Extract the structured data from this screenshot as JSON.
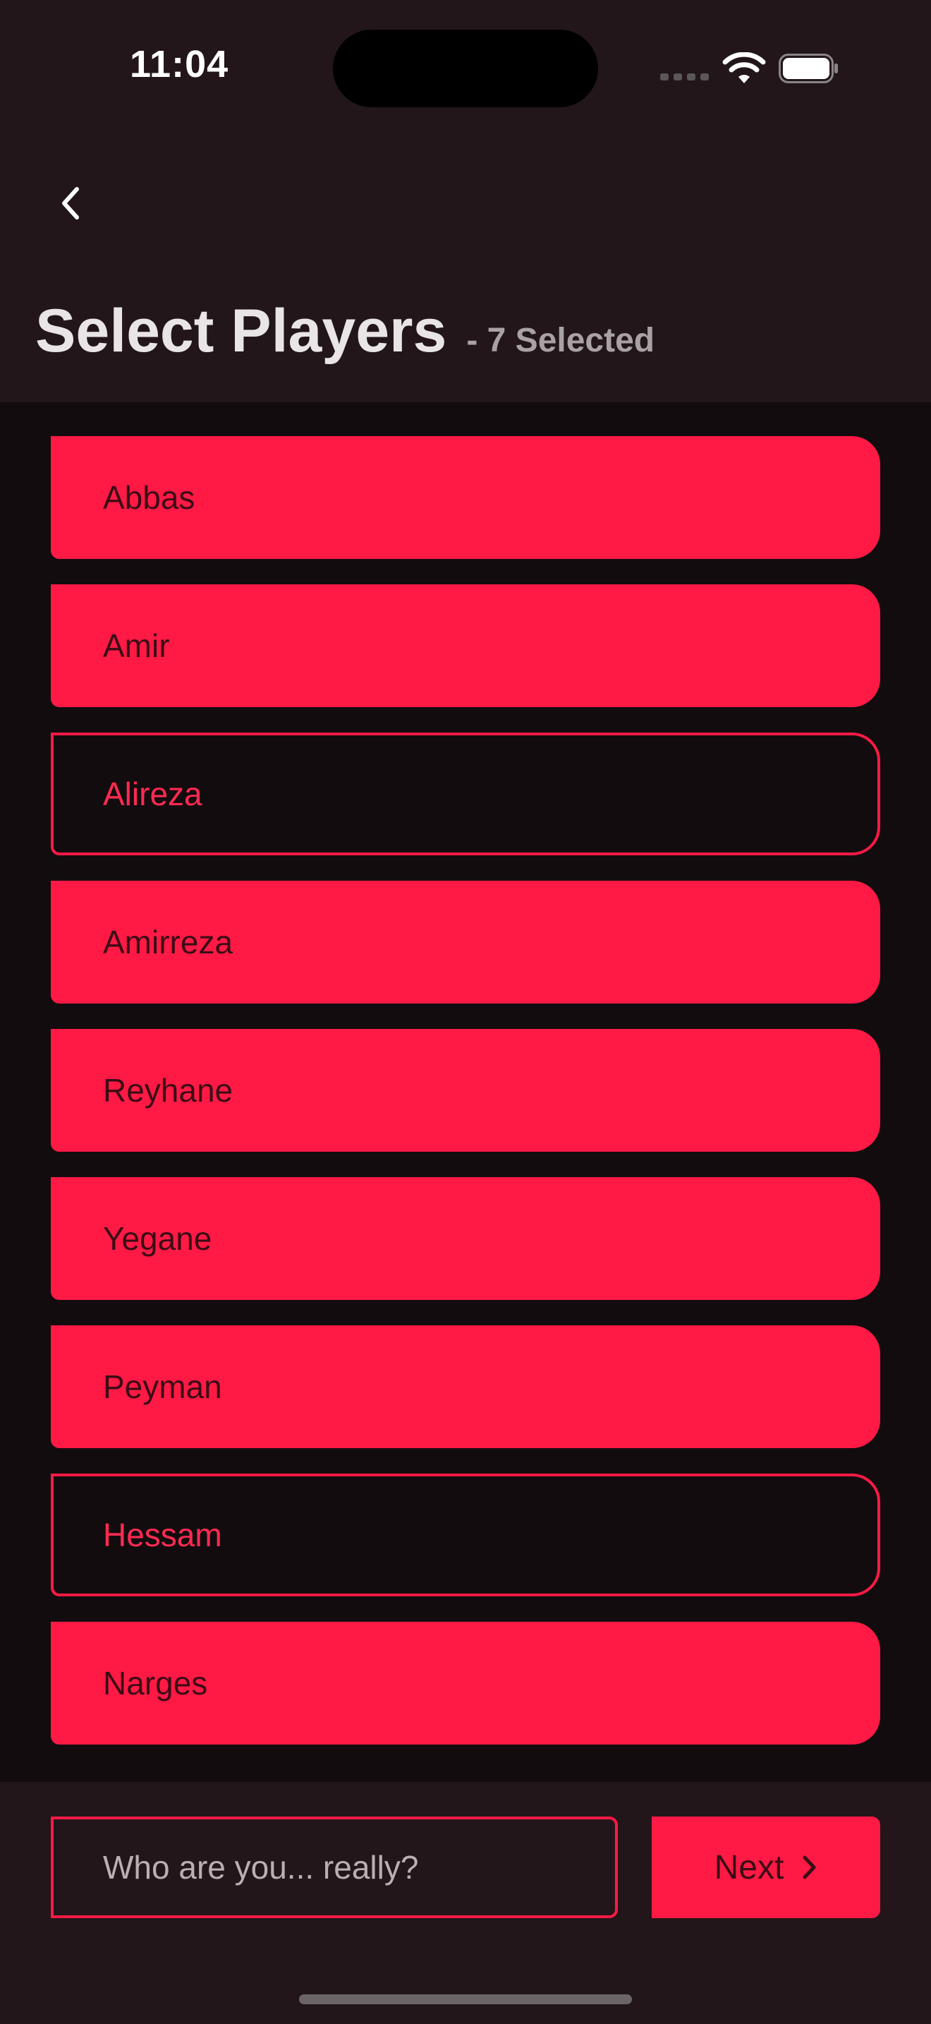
{
  "status_bar": {
    "time": "11:04"
  },
  "header": {
    "title": "Select Players",
    "selected_count": "- 7 Selected"
  },
  "players": [
    {
      "name": "Abbas",
      "selected": true
    },
    {
      "name": "Amir",
      "selected": true
    },
    {
      "name": "Alireza",
      "selected": false
    },
    {
      "name": "Amirreza",
      "selected": true
    },
    {
      "name": "Reyhane",
      "selected": true
    },
    {
      "name": "Yegane",
      "selected": true
    },
    {
      "name": "Peyman",
      "selected": true
    },
    {
      "name": "Hessam",
      "selected": false
    },
    {
      "name": "Narges",
      "selected": true
    }
  ],
  "footer": {
    "input_placeholder": "Who are you... really?",
    "input_value": "",
    "next_label": "Next"
  },
  "colors": {
    "accent": "#ff1a45",
    "background": "#130c0f",
    "header_background": "#22161a"
  },
  "icons": {
    "back": "chevron-left-icon",
    "next": "chevron-right-icon",
    "wifi": "wifi-icon",
    "battery": "battery-icon",
    "signal": "cellular-signal-icon"
  }
}
